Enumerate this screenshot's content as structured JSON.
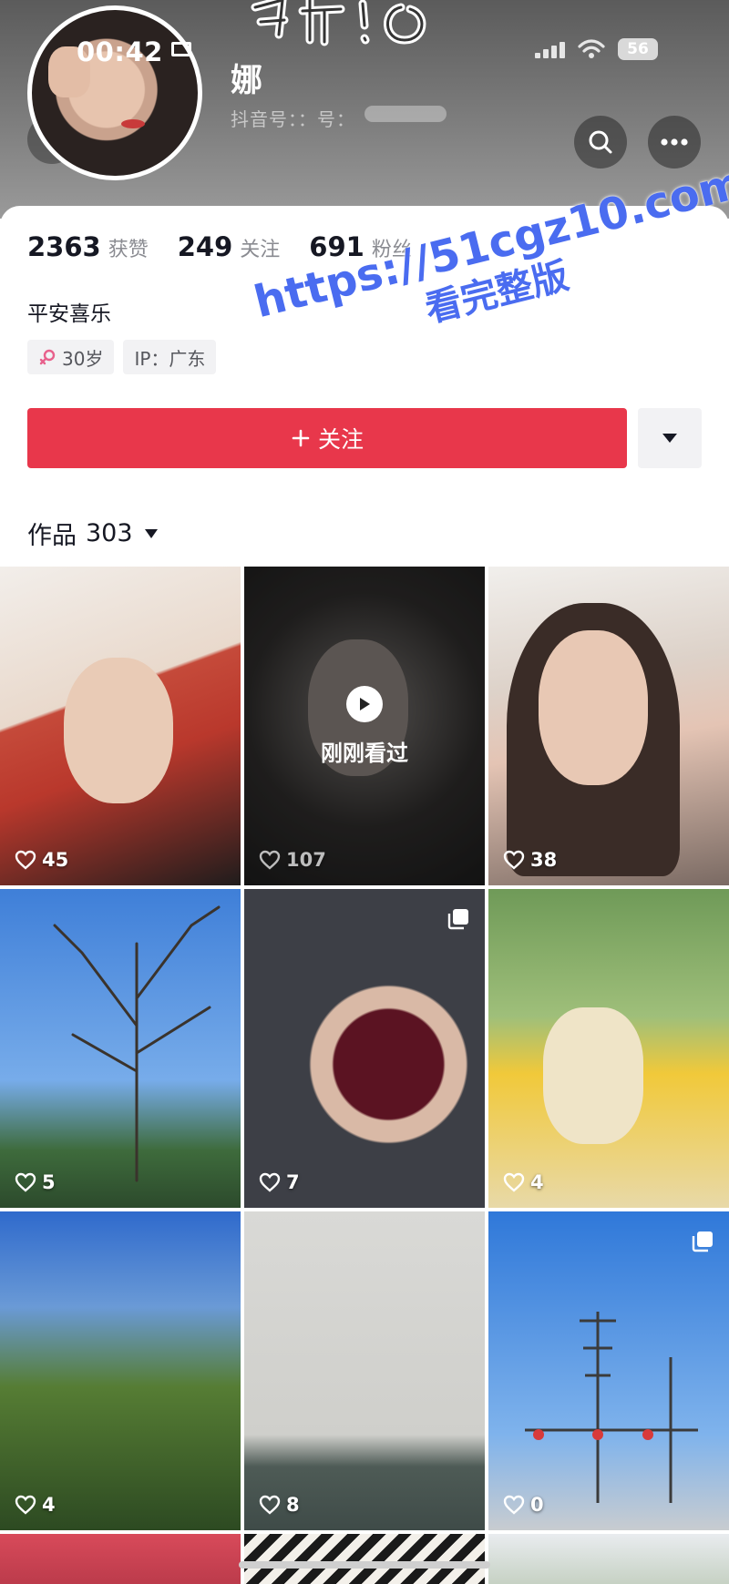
{
  "status_bar": {
    "time": "00:42",
    "battery": "56"
  },
  "profile": {
    "nickname": "娜",
    "douyin_id_prefix": "抖音号：：号：",
    "bio": "平安喜乐",
    "tags": [
      {
        "icon": "female-icon",
        "label": "30岁"
      },
      {
        "icon": null,
        "label": "IP：广东"
      }
    ]
  },
  "stats": [
    {
      "value": "2363",
      "label": "获赞"
    },
    {
      "value": "249",
      "label": "关注"
    },
    {
      "value": "691",
      "label": "粉丝"
    }
  ],
  "actions": {
    "follow_label": "关注",
    "more_menu_icon": "caret-down-icon"
  },
  "works": {
    "label": "作品",
    "count": "303"
  },
  "watermark": {
    "line1": "https://51cgz10.com",
    "line2": "看完整版"
  },
  "grid": [
    {
      "likes": "45"
    },
    {
      "likes": "107",
      "overlay_text": "刚刚看过"
    },
    {
      "likes": "38"
    },
    {
      "likes": "5"
    },
    {
      "likes": "7"
    },
    {
      "likes": "4"
    },
    {
      "likes": "4"
    },
    {
      "likes": "8"
    },
    {
      "likes": "0"
    }
  ],
  "colors": {
    "accent": "#E8374B",
    "text_primary": "#161823",
    "text_secondary": "#8A8B91",
    "watermark": "#4A6CF0"
  }
}
